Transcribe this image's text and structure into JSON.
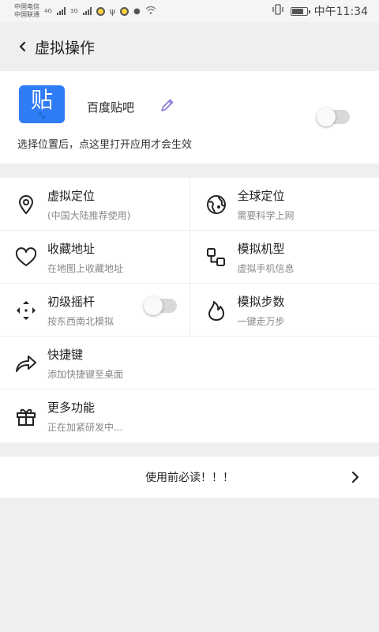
{
  "status_bar": {
    "carrier_1": "中国电信",
    "carrier_2": "中国联通",
    "net_1": "4G",
    "net_2": "3G",
    "time": "中午11:34"
  },
  "header": {
    "back_icon": "chevron-left-icon",
    "title": "虚拟操作"
  },
  "app_card": {
    "icon_glyph": "贴",
    "icon_paw": "🐾",
    "icon_color": "#2f7cf6",
    "app_name": "百度贴吧",
    "edit_icon": "pencil-icon",
    "edit_icon_color": "#8a74d6",
    "toggle_on": false,
    "hint": "选择位置后，点这里打开应用才会生效"
  },
  "features": [
    {
      "title": "虚拟定位",
      "subtitle": "(中国大陆推荐使用)",
      "icon": "location-pin-icon"
    },
    {
      "title": "全球定位",
      "subtitle": "需要科学上网",
      "icon": "globe-icon"
    },
    {
      "title": "收藏地址",
      "subtitle": "在地图上收藏地址",
      "icon": "heart-icon"
    },
    {
      "title": "模拟机型",
      "subtitle": "虚拟手机信息",
      "icon": "device-model-icon"
    },
    {
      "title": "初级摇杆",
      "subtitle": "按东西南北模拟",
      "icon": "move-arrows-icon",
      "toggle_on": false
    },
    {
      "title": "模拟步数",
      "subtitle": "一键走万步",
      "icon": "flame-icon"
    },
    {
      "title": "快捷键",
      "subtitle": "添加快捷键至桌面",
      "icon": "share-arrow-icon"
    },
    {
      "title": "更多功能",
      "subtitle": "正在加紧研发中...",
      "icon": "gift-icon"
    }
  ],
  "footer": {
    "must_read": "使用前必读！！！",
    "chevron_icon": "chevron-right-icon"
  }
}
